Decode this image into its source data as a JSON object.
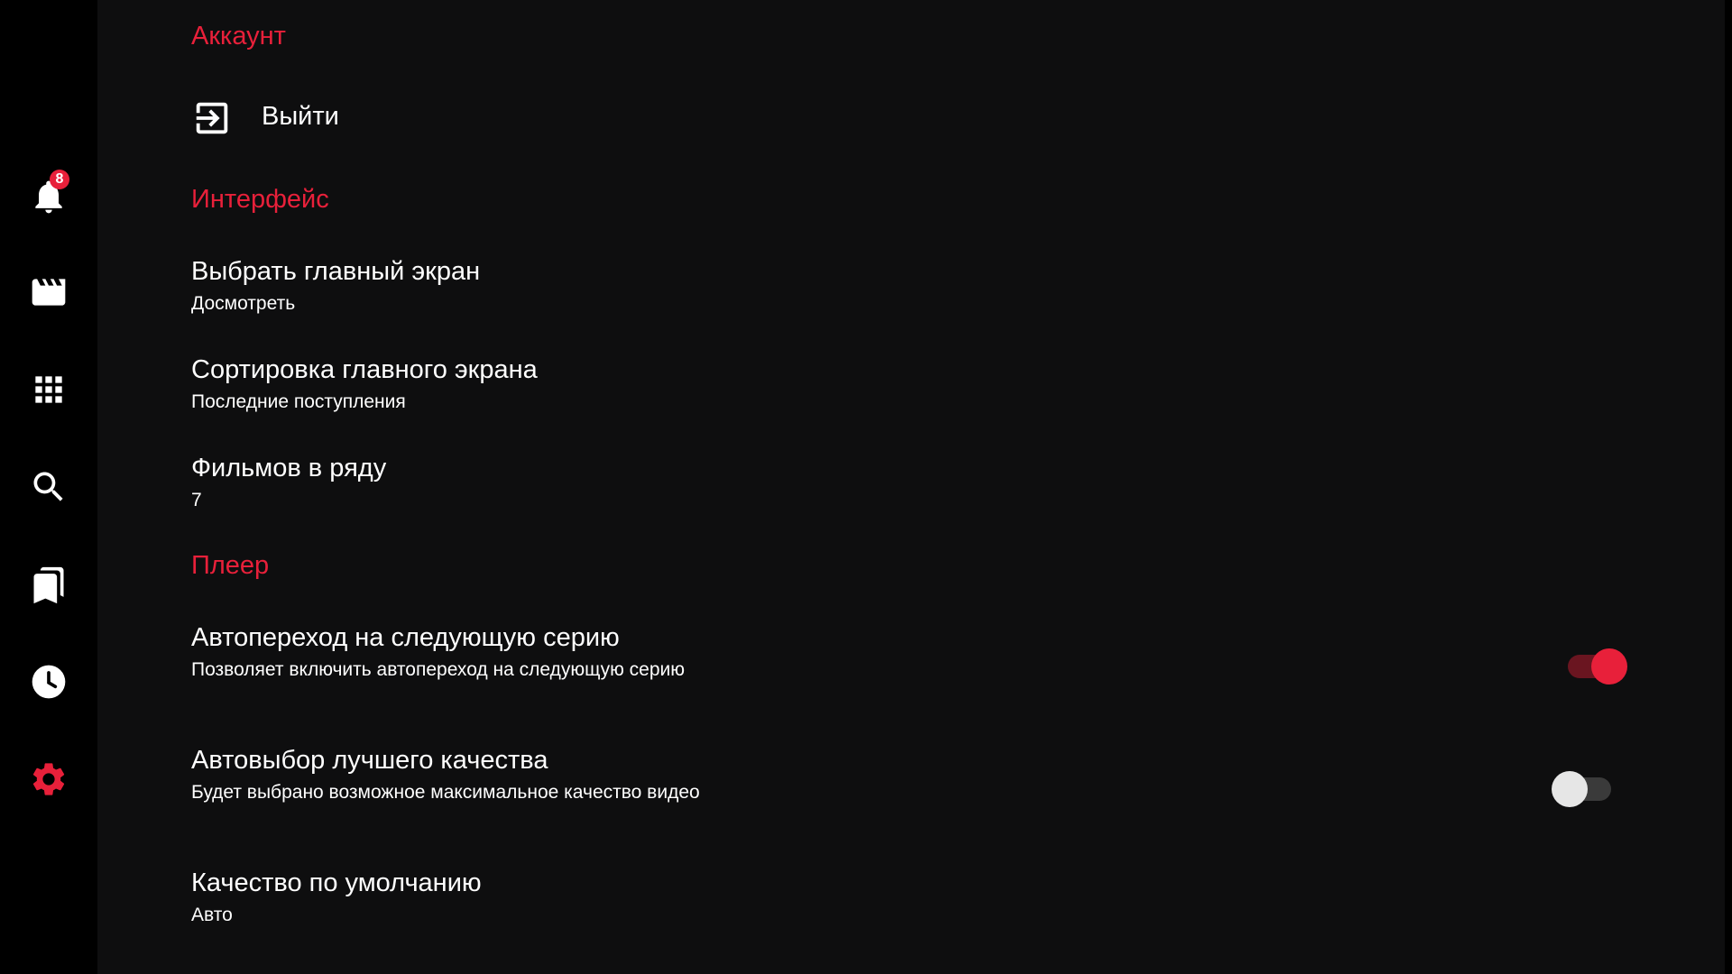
{
  "sidebar": {
    "notifications": {
      "icon": "bell-icon",
      "badge": "8"
    },
    "items": [
      {
        "icon": "movie-clapper-icon"
      },
      {
        "icon": "apps-grid-icon"
      },
      {
        "icon": "search-icon"
      },
      {
        "icon": "bookmarks-icon"
      },
      {
        "icon": "clock-icon"
      },
      {
        "icon": "gear-icon",
        "active": true
      }
    ]
  },
  "colors": {
    "accent": "#e8203a",
    "background": "#0e0e0f",
    "sidebar": "#000000"
  },
  "sections": {
    "account": {
      "title": "Аккаунт",
      "logout": {
        "label": "Выйти",
        "icon": "logout-icon"
      }
    },
    "interface": {
      "title": "Интерфейс",
      "main_screen": {
        "title": "Выбрать главный экран",
        "summary": "Досмотреть"
      },
      "sorting": {
        "title": "Сортировка главного экрана",
        "summary": "Последние поступления"
      },
      "movies_per_row": {
        "title": "Фильмов в ряду",
        "summary": "7"
      }
    },
    "player": {
      "title": "Плеер",
      "autonext": {
        "title": "Автопереход на следующую серию",
        "summary": "Позволяет включить автопереход на следующую серию",
        "enabled": true
      },
      "autoquality": {
        "title": "Автовыбор лучшего качества",
        "summary": "Будет выбрано возможное максимальное качество видео",
        "enabled": false
      },
      "default_quality": {
        "title": "Качество по умолчанию",
        "summary": "Авто"
      }
    }
  }
}
